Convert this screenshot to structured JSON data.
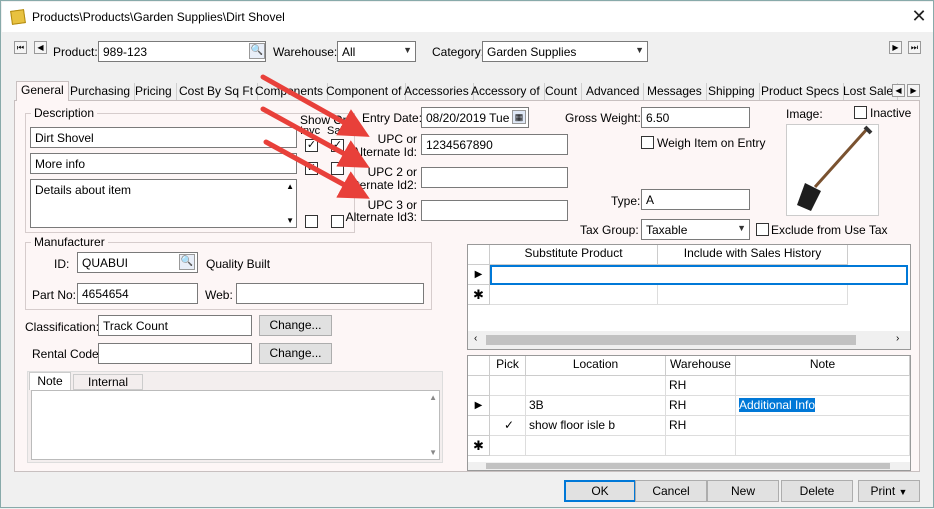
{
  "window": {
    "title": "Products\\Products\\Garden Supplies\\Dirt Shovel"
  },
  "header": {
    "product_label": "Product:",
    "product_value": "989-123",
    "warehouse_label": "Warehouse:",
    "warehouse_value": "All",
    "category_label": "Category:",
    "category_value": "Garden Supplies"
  },
  "tabs": [
    "General",
    "Purchasing",
    "Pricing",
    "Cost By Sq Ft",
    "Components",
    "Component of",
    "Accessories",
    "Accessory of",
    "Count",
    "Advanced",
    "Messages",
    "Shipping",
    "Product Specs",
    "Lost Sale"
  ],
  "description": {
    "title": "Description",
    "show_on_label": "Show On",
    "inv_label": "Invc",
    "sal_label": "Sale",
    "line1": "Dirt Shovel",
    "line2": "More info",
    "details": "Details about item"
  },
  "entry": {
    "entry_date_label": "Entry Date:",
    "entry_date_value": "08/20/2019 Tue"
  },
  "upc": {
    "upc1_label_a": "UPC or",
    "upc1_label_b": "Alternate Id:",
    "upc1_value": "1234567890",
    "upc2_label_a": "UPC 2 or",
    "upc2_label_b": "Alternate Id2:",
    "upc2_value": "",
    "upc3_label_a": "UPC 3 or",
    "upc3_label_b": "Alternate Id3:",
    "upc3_value": ""
  },
  "weight": {
    "label": "Gross Weight:",
    "value": "6.50",
    "weigh_label": "Weigh Item on Entry"
  },
  "type": {
    "label": "Type:",
    "value": "A"
  },
  "tax": {
    "label": "Tax Group:",
    "value": "Taxable",
    "exclude_label": "Exclude from Use Tax"
  },
  "image": {
    "label": "Image:",
    "inactive_label": "Inactive"
  },
  "manufacturer": {
    "title": "Manufacturer",
    "id_label": "ID:",
    "id_value": "QUABUI",
    "name": "Quality Built",
    "partno_label": "Part No:",
    "partno_value": "4654654",
    "web_label": "Web:",
    "web_value": ""
  },
  "classification": {
    "label": "Classification:",
    "value": "Track Count",
    "change_label": "Change..."
  },
  "rental": {
    "label": "Rental Code:",
    "value": "",
    "change_label": "Change..."
  },
  "notes": {
    "tab_note": "Note",
    "tab_internal": "Internal Note"
  },
  "substitute_grid": {
    "headers": [
      "Substitute Product",
      "Include with Sales History"
    ]
  },
  "location_grid": {
    "headers": [
      "Pick",
      "Location",
      "Warehouse",
      "Note"
    ],
    "rows": [
      {
        "pick": "",
        "location": "",
        "warehouse": "RH",
        "note": ""
      },
      {
        "pick": "",
        "location": "3B",
        "warehouse": "RH",
        "note": "Additional Info"
      },
      {
        "pick": "✓",
        "location": "show floor isle b",
        "warehouse": "RH",
        "note": ""
      }
    ]
  },
  "footer": {
    "ok": "OK",
    "cancel": "Cancel",
    "new": "New",
    "delete": "Delete",
    "print": "Print"
  },
  "colors": {
    "accent": "#0078d7",
    "arrow": "#e8403a",
    "pane": "#fdf6f6"
  }
}
